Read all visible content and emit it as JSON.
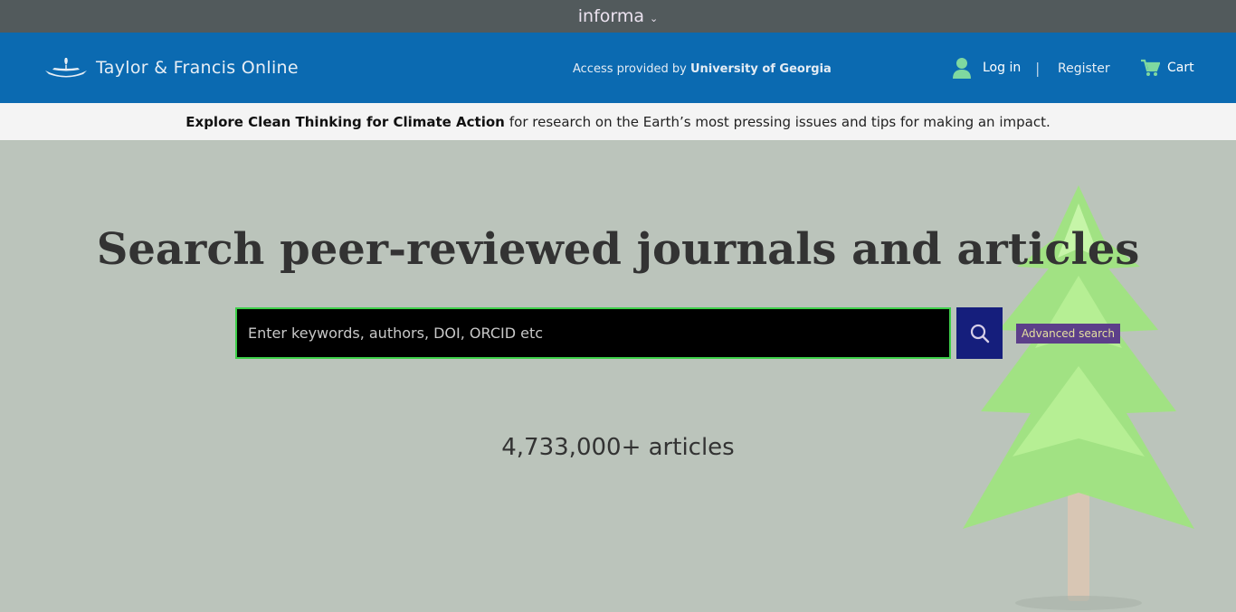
{
  "informa": {
    "label": "informa"
  },
  "header": {
    "logo_text": "Taylor & Francis Online",
    "access_prefix": "Access provided by",
    "access_institution": "University of Georgia",
    "login_label": "Log in",
    "separator": "|",
    "register_label": "Register",
    "cart_label": "Cart"
  },
  "promo": {
    "link_text": "Explore Clean Thinking for Climate Action",
    "rest_text": "for research on the Earth’s most pressing issues and tips for making an impact."
  },
  "hero": {
    "title": "Search peer-reviewed journals and articles",
    "search_placeholder": "Enter keywords, authors, DOI, ORCID etc",
    "advanced_label": "Advanced search",
    "article_count": "4,733,000+ articles"
  },
  "colors": {
    "informa_bar": "#525a5c",
    "header_bg": "#0b6ab1",
    "promo_bg": "#f4f4f4",
    "hero_bg": "#bbc4bb",
    "search_button": "#151e7c",
    "search_border": "#3dcf49",
    "tree": "#9fe57d"
  }
}
